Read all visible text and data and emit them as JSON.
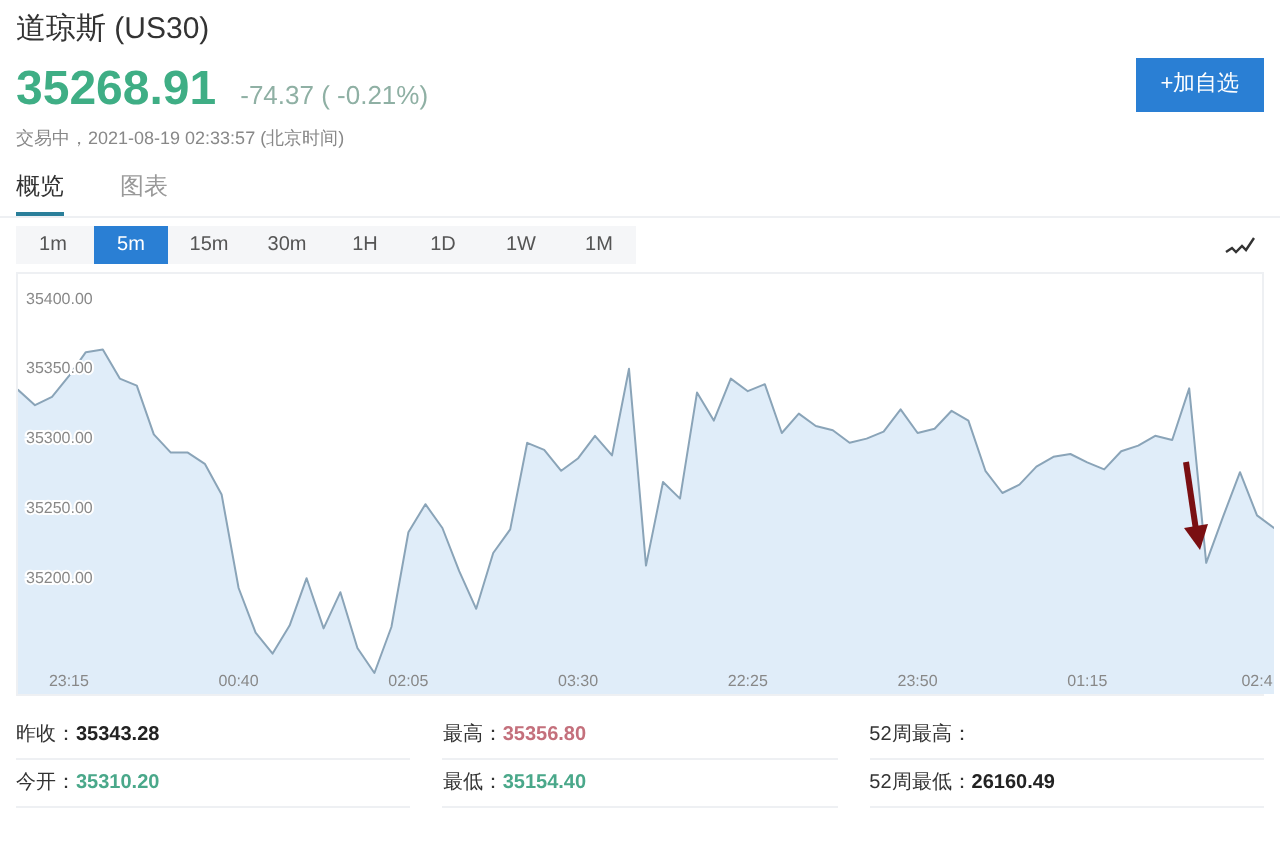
{
  "header": {
    "title": "道琼斯 (US30)",
    "price": "35268.91",
    "change": "-74.37 ( -0.21%)",
    "status": "交易中，2021-08-19 02:33:57 (北京时间)",
    "add_button": "+加自选"
  },
  "tabs": [
    {
      "label": "概览",
      "selected": true
    },
    {
      "label": "图表",
      "selected": false
    }
  ],
  "ranges": [
    {
      "label": "1m",
      "selected": false
    },
    {
      "label": "5m",
      "selected": true
    },
    {
      "label": "15m",
      "selected": false
    },
    {
      "label": "30m",
      "selected": false
    },
    {
      "label": "1H",
      "selected": false
    },
    {
      "label": "1D",
      "selected": false
    },
    {
      "label": "1W",
      "selected": false
    },
    {
      "label": "1M",
      "selected": false
    }
  ],
  "chart_data": {
    "type": "area",
    "ylim": [
      35116,
      35417
    ],
    "yticks": [
      {
        "value": 35200,
        "label": "35200.00"
      },
      {
        "value": 35250,
        "label": "35250.00"
      },
      {
        "value": 35300,
        "label": "35300.00"
      },
      {
        "value": 35350,
        "label": "35350.00"
      },
      {
        "value": 35400,
        "label": "35400.00"
      }
    ],
    "categories": [
      null,
      null,
      null,
      "23:15",
      null,
      null,
      null,
      null,
      null,
      null,
      null,
      null,
      null,
      "00:40",
      null,
      null,
      null,
      null,
      null,
      null,
      null,
      null,
      null,
      "02:05",
      null,
      null,
      null,
      null,
      null,
      null,
      null,
      null,
      null,
      "03:30",
      null,
      null,
      null,
      null,
      null,
      null,
      null,
      null,
      null,
      "22:25",
      null,
      null,
      null,
      null,
      null,
      null,
      null,
      null,
      null,
      "23:50",
      null,
      null,
      null,
      null,
      null,
      null,
      null,
      null,
      null,
      "01:15",
      null,
      null,
      null,
      null,
      null,
      null,
      null,
      null,
      null,
      "02:4",
      null
    ],
    "series": [
      {
        "color": "#8aa4b8",
        "values": [
          35334,
          35323,
          35329,
          35344,
          35361,
          35363,
          35342,
          35337,
          35302,
          35289,
          35289,
          35281,
          35259,
          35192,
          35160,
          35145,
          35165,
          35199,
          35163,
          35189,
          35149,
          35131,
          35164,
          35232,
          35252,
          35235,
          35204,
          35177,
          35217,
          35234,
          35296,
          35291,
          35276,
          35285,
          35301,
          35287,
          35349,
          35208,
          35268,
          35256,
          35332,
          35312,
          35342,
          35333,
          35338,
          35303,
          35317,
          35308,
          35305,
          35296,
          35299,
          35304,
          35320,
          35303,
          35306,
          35319,
          35312,
          35276,
          35260,
          35266,
          35279,
          35286,
          35288,
          35282,
          35277,
          35290,
          35294,
          35301,
          35298,
          35335,
          35210,
          35243,
          35275,
          35244,
          35235
        ]
      }
    ]
  },
  "stats": [
    {
      "label": "昨收：",
      "value": "35343.28",
      "color": "#222222"
    },
    {
      "label": "最高：",
      "value": "35356.80",
      "color": "#c4707c"
    },
    {
      "label": "52周最高："
    },
    {
      "label": "今开：",
      "value": "35310.20",
      "color": "#4aa88a"
    },
    {
      "label": "最低：",
      "value": "35154.40",
      "color": "#4aa88a"
    },
    {
      "label": "52周最低：",
      "value": "26160.49",
      "color": "#222222"
    }
  ]
}
